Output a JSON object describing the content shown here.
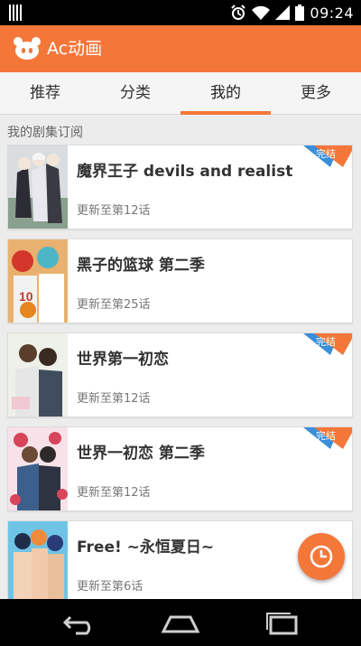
{
  "status_bar": {
    "time": "09:24",
    "icons": [
      "sim-icon",
      "alarm-icon",
      "wifi-icon",
      "signal-icon",
      "battery-icon"
    ]
  },
  "app_bar": {
    "title": "Ac动画",
    "logo_icon": "ac-logo-icon",
    "accent_color": "#f4773a"
  },
  "tabs": [
    {
      "label": "推荐"
    },
    {
      "label": "分类"
    },
    {
      "label": "我的",
      "active": true
    },
    {
      "label": "更多"
    }
  ],
  "section": {
    "title": "我的剧集订阅"
  },
  "subscriptions": [
    {
      "title": "魔界王子 devils and realist",
      "update": "更新至第12话",
      "badge": "完结"
    },
    {
      "title": "黑子的篮球 第二季",
      "update": "更新至第25话",
      "badge": ""
    },
    {
      "title": "世界第一初恋",
      "update": "更新至第12话",
      "badge": "完结"
    },
    {
      "title": "世界一初恋 第二季",
      "update": "更新至第12话",
      "badge": "完结"
    },
    {
      "title": "Free! ~永恒夏日~",
      "update": "更新至第6话",
      "badge": ""
    }
  ],
  "fab": {
    "icon": "clock-icon"
  },
  "nav_bar": {
    "icons": [
      "back-icon",
      "home-icon",
      "recents-icon"
    ]
  }
}
